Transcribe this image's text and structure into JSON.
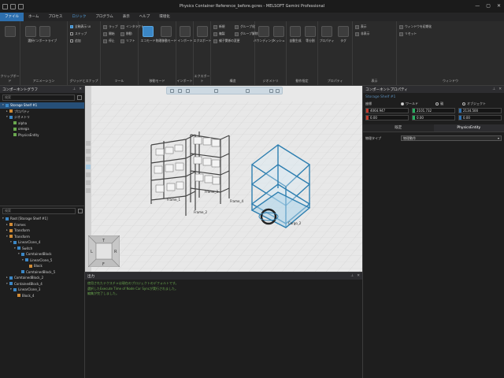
{
  "window": {
    "title": "Physics Container Reference_before.gcres - MELSOFT Gemini Professional",
    "controls": [
      "—",
      "▢",
      "✕"
    ]
  },
  "menu": [
    {
      "label": "ファイル",
      "state": "active"
    },
    {
      "label": "ホーム",
      "state": ""
    },
    {
      "label": "プロセス",
      "state": ""
    },
    {
      "label": "ロジック",
      "state": "blue"
    },
    {
      "label": "プログラム",
      "state": ""
    },
    {
      "label": "表示",
      "state": ""
    },
    {
      "label": "ヘルプ",
      "state": ""
    },
    {
      "label": "環境化",
      "state": ""
    }
  ],
  "ribbon": {
    "groups": [
      {
        "label": "クリップボード"
      },
      {
        "label": "アニメーション"
      },
      {
        "label": "グリッドとスナップ"
      },
      {
        "label": "ツール"
      },
      {
        "label": "移動モード"
      },
      {
        "label": "インポート"
      },
      {
        "label": "エクスポート"
      },
      {
        "label": "構造"
      },
      {
        "label": "ジオメトリ"
      },
      {
        "label": "動作指定"
      },
      {
        "label": "プロパティ"
      },
      {
        "label": "表示"
      },
      {
        "label": "ウィンドウ"
      }
    ],
    "buttons": {
      "select": "選択",
      "move": "インポートライブ",
      "play": "開始",
      "pause": "停止",
      "grid_show": "全軸表示 UI",
      "snap": "ステップ",
      "snap_center": "追加",
      "wrap": "ラップ",
      "interact_rotate": "インタラクト",
      "move_tool": "移動",
      "scale_tool": "リフト",
      "eco_mode": "エコモード",
      "physics_mode": "物理移動モード",
      "import": "インポート",
      "export": "エクスポート",
      "new": "新規",
      "copy": "複製",
      "delete": "削除",
      "align_group": "グループ化",
      "ungroup": "グループ解除",
      "reparent": "親子関係の変更",
      "boundary": "バウンディング",
      "cage_frame": "ケージ",
      "mesh": "メッシュ",
      "auto": "自動生成",
      "equal_split": "等分割",
      "apply": "適用",
      "property": "プロパティ",
      "tag": "タグ",
      "show": "表示",
      "hide": "非表示",
      "window_init": "ウィンドウを初期化",
      "reset": "リセット"
    }
  },
  "left": {
    "component_graph_title": "コンポーネントグラフ",
    "search_placeholder": "検索",
    "graph_items": [
      {
        "label": "Storage Shelf #1",
        "depth": 0,
        "selected": true,
        "icon": "blue",
        "arrow": "▾"
      },
      {
        "label": "プロパティ",
        "depth": 1,
        "selected": false,
        "icon": "orange",
        "arrow": "▸"
      },
      {
        "label": "ジオメトリ",
        "depth": 1,
        "selected": false,
        "icon": "blue",
        "arrow": "▾"
      },
      {
        "label": "alpha",
        "depth": 2,
        "selected": false,
        "icon": "green",
        "arrow": ""
      },
      {
        "label": "omega",
        "depth": 2,
        "selected": false,
        "icon": "green",
        "arrow": ""
      },
      {
        "label": "PhysicsEntity",
        "depth": 2,
        "selected": false,
        "icon": "green",
        "arrow": ""
      }
    ],
    "tree_search_placeholder": "検索",
    "tree_items": [
      {
        "label": "Root [Storage Shelf #1]",
        "depth": 0,
        "icon": "blue",
        "arrow": "▾"
      },
      {
        "label": "Frames",
        "depth": 1,
        "icon": "orange",
        "arrow": "▸"
      },
      {
        "label": "Transform",
        "depth": 1,
        "icon": "orange",
        "arrow": "▸"
      },
      {
        "label": "Transform",
        "depth": 1,
        "icon": "orange",
        "arrow": "▾"
      },
      {
        "label": "LinearClone_4",
        "depth": 2,
        "icon": "blue",
        "arrow": "▾"
      },
      {
        "label": "Switch",
        "depth": 3,
        "icon": "blue",
        "arrow": "▾"
      },
      {
        "label": "ComtainedBlock",
        "depth": 4,
        "icon": "blue",
        "arrow": "▾"
      },
      {
        "label": "LinearClone_5",
        "depth": 5,
        "icon": "blue",
        "arrow": "▾"
      },
      {
        "label": "Block",
        "depth": 6,
        "icon": "orange",
        "arrow": ""
      },
      {
        "label": "ComtainedBlock_5",
        "depth": 4,
        "icon": "blue",
        "arrow": ""
      },
      {
        "label": "ComtainedBlock_2",
        "depth": 1,
        "icon": "blue",
        "arrow": "▸"
      },
      {
        "label": "ContainedBlock_4",
        "depth": 1,
        "icon": "blue",
        "arrow": "▾"
      },
      {
        "label": "LinearClone_3",
        "depth": 2,
        "icon": "blue",
        "arrow": "▾"
      },
      {
        "label": "Block_4",
        "depth": 3,
        "icon": "orange",
        "arrow": ""
      }
    ]
  },
  "viewport": {
    "labels": {
      "frame1": "Frame_1",
      "frame2": "Frame_2",
      "frame3": "Frame_3",
      "frame4": "Frame_4",
      "cargo": "Cargo_2"
    },
    "nav_cube": {
      "top": "T",
      "left": "L",
      "right": "R",
      "bottom": "F"
    }
  },
  "output": {
    "title": "出力",
    "lines": [
      "使用されたテクスチャは現在のプロジェクトのデフォルトです。",
      "選択したExecute Time of Node Car Syncが実行されました。",
      "編集が完了しました。"
    ]
  },
  "right": {
    "title": "コンポーネントプロパティ",
    "name": "Storage Shelf #1",
    "coord_label": "座標",
    "coord_options": [
      {
        "label": "ワールド",
        "checked": true
      },
      {
        "label": "親",
        "checked": false
      },
      {
        "label": "オブジェクト",
        "checked": false
      }
    ],
    "position": [
      {
        "axis": "X",
        "color": "#c0392b",
        "value": "4064.947"
      },
      {
        "axis": "Y",
        "color": "#27ae60",
        "value": "2101.732"
      },
      {
        "axis": "Z",
        "color": "#2d6fae",
        "value": "2134.500"
      }
    ],
    "rotation": [
      {
        "axis": "X",
        "color": "#c0392b",
        "value": "0.00"
      },
      {
        "axis": "Y",
        "color": "#27ae60",
        "value": "0.00"
      },
      {
        "axis": "Z",
        "color": "#2d6fae",
        "value": "0.00"
      }
    ],
    "tabs": [
      {
        "label": "既定",
        "active": false
      },
      {
        "label": "PhysicsEntity",
        "active": true
      }
    ],
    "physics_type_label": "物理タイプ",
    "physics_type_value": "物理動作"
  }
}
